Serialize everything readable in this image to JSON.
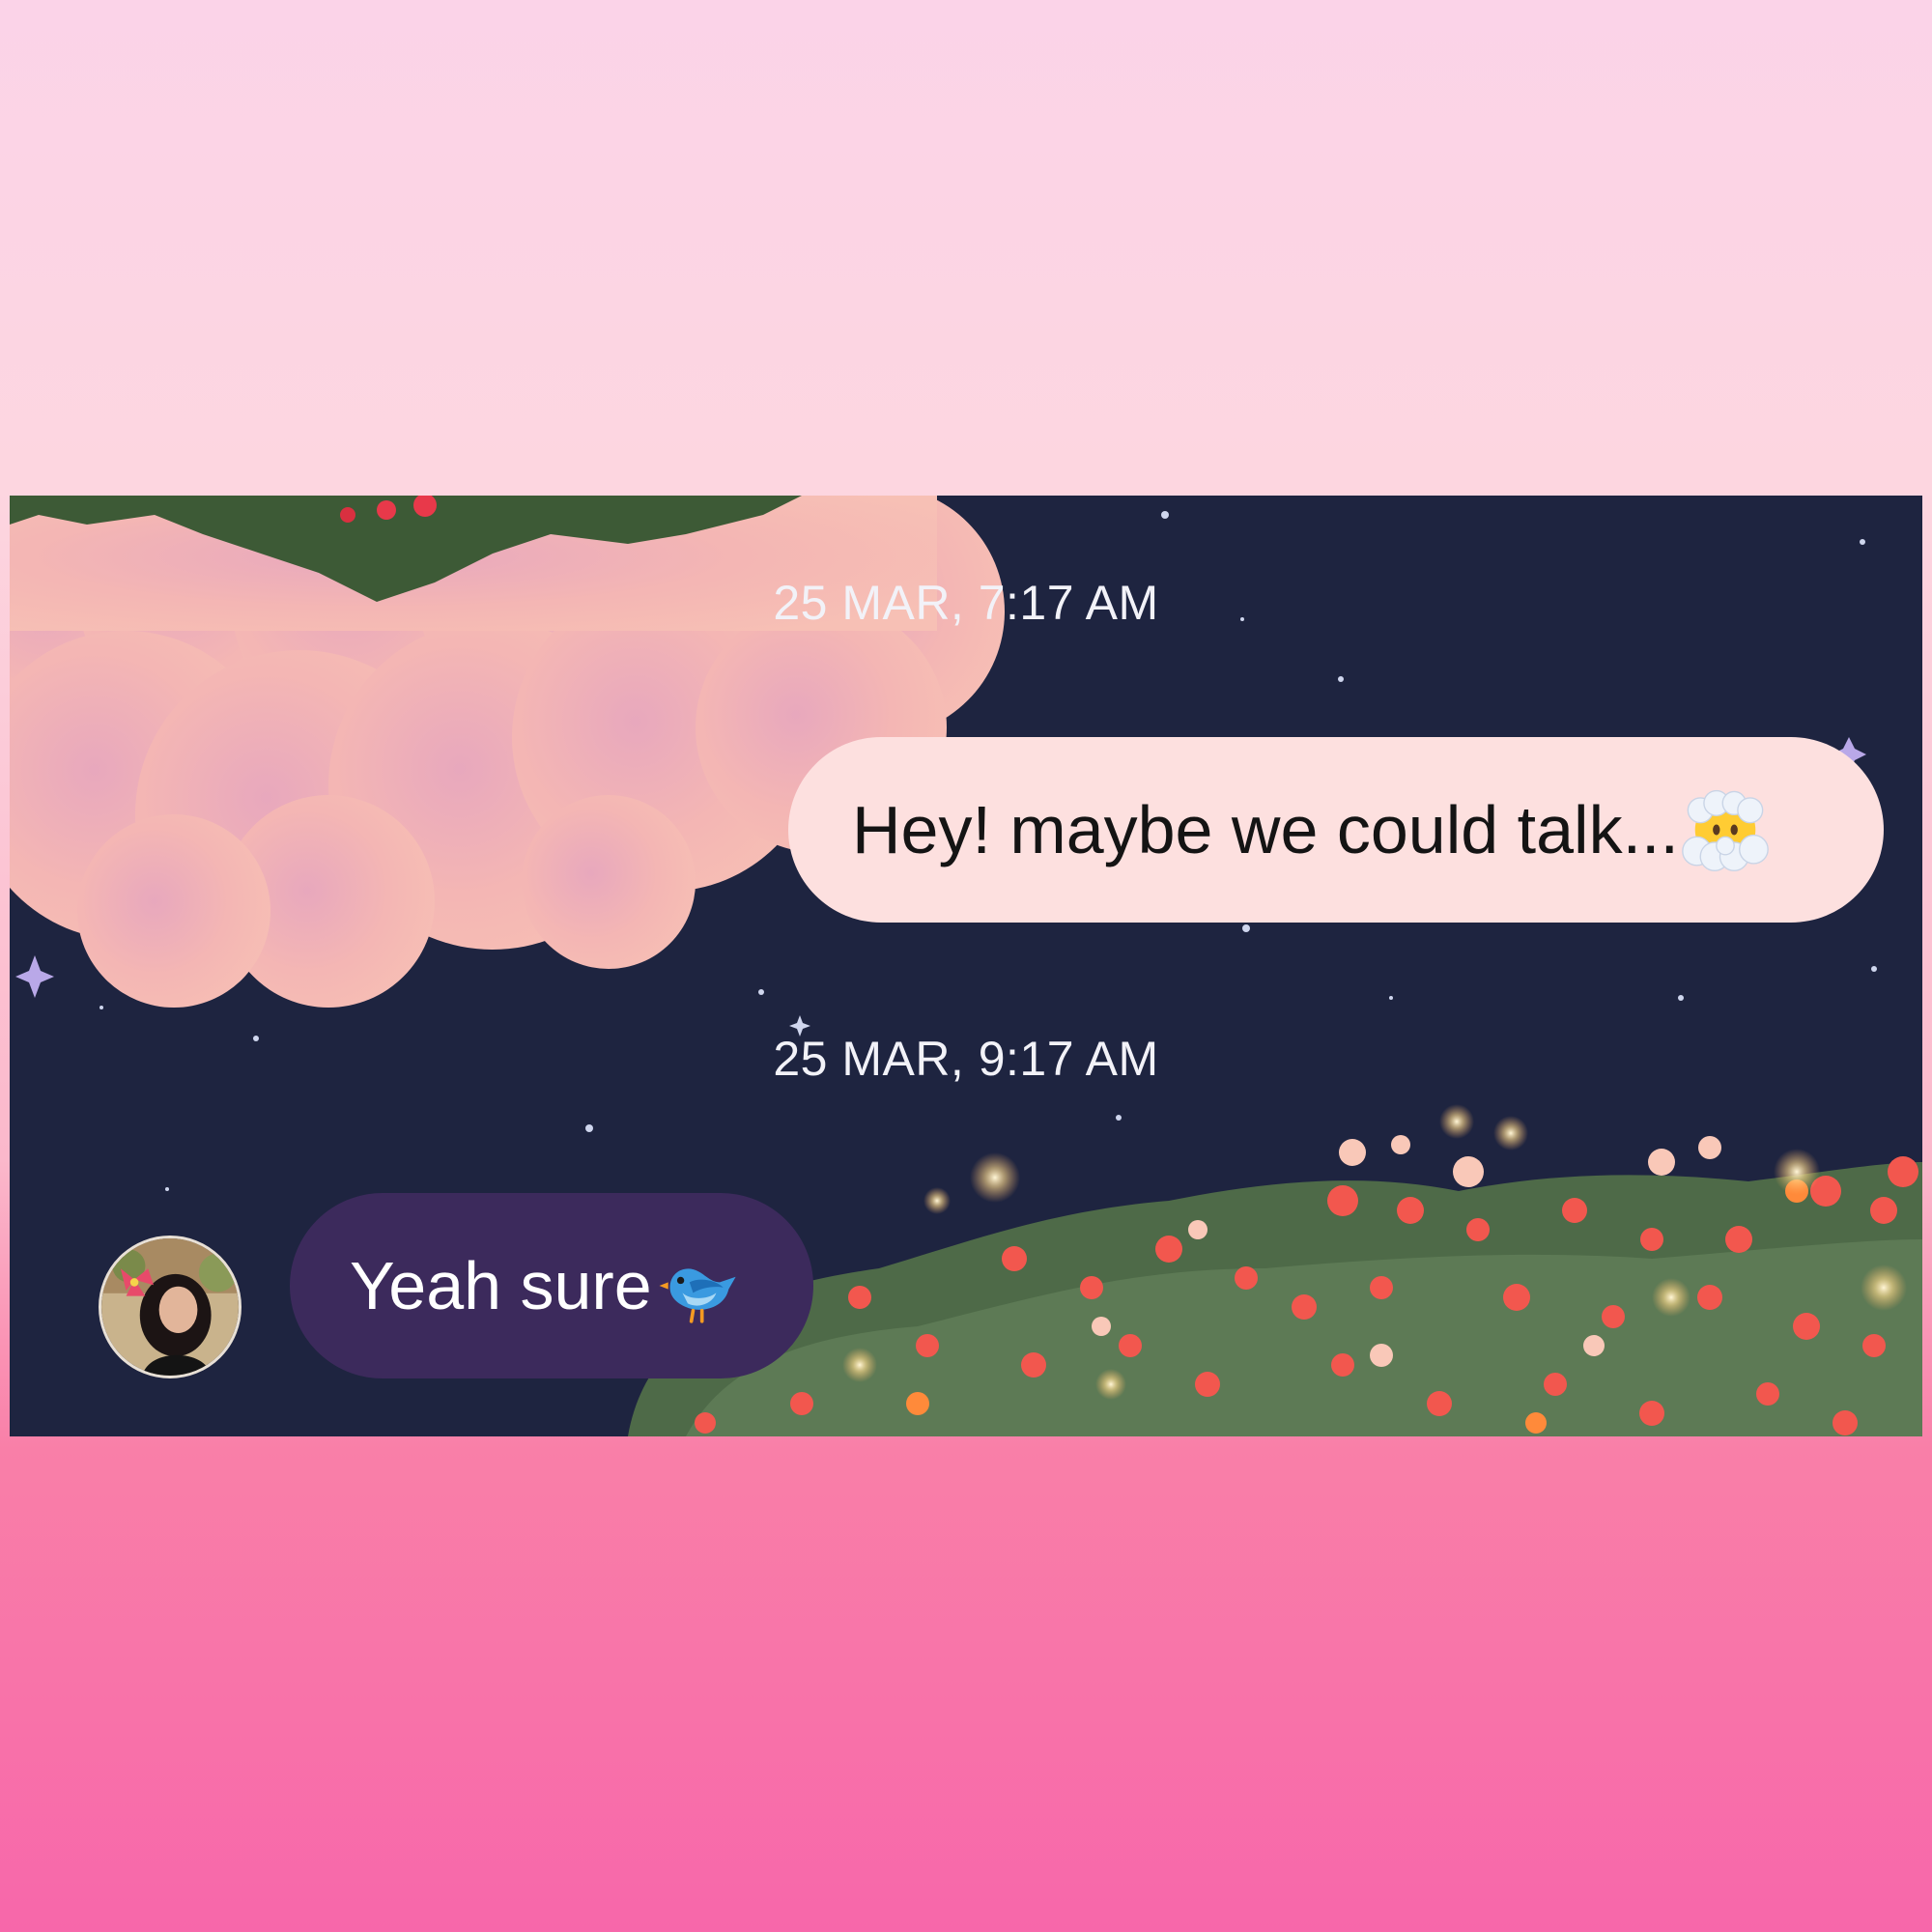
{
  "chat": {
    "timestamps": [
      "25 MAR, 7:17 AM",
      "25 MAR, 9:17 AM"
    ],
    "messages": [
      {
        "direction": "outgoing",
        "text": "Hey! maybe we could talk...",
        "emoji": "face-in-clouds-emoji"
      },
      {
        "direction": "incoming",
        "text": "Yeah sure",
        "emoji": "bluebird-emoji"
      }
    ]
  },
  "theme": {
    "background_top": "#fbd3e8",
    "background_bottom": "#f767aa",
    "chat_background": "#1e2440",
    "outgoing_bubble": "#fde0df",
    "incoming_bubble": "#3c2a5c"
  }
}
